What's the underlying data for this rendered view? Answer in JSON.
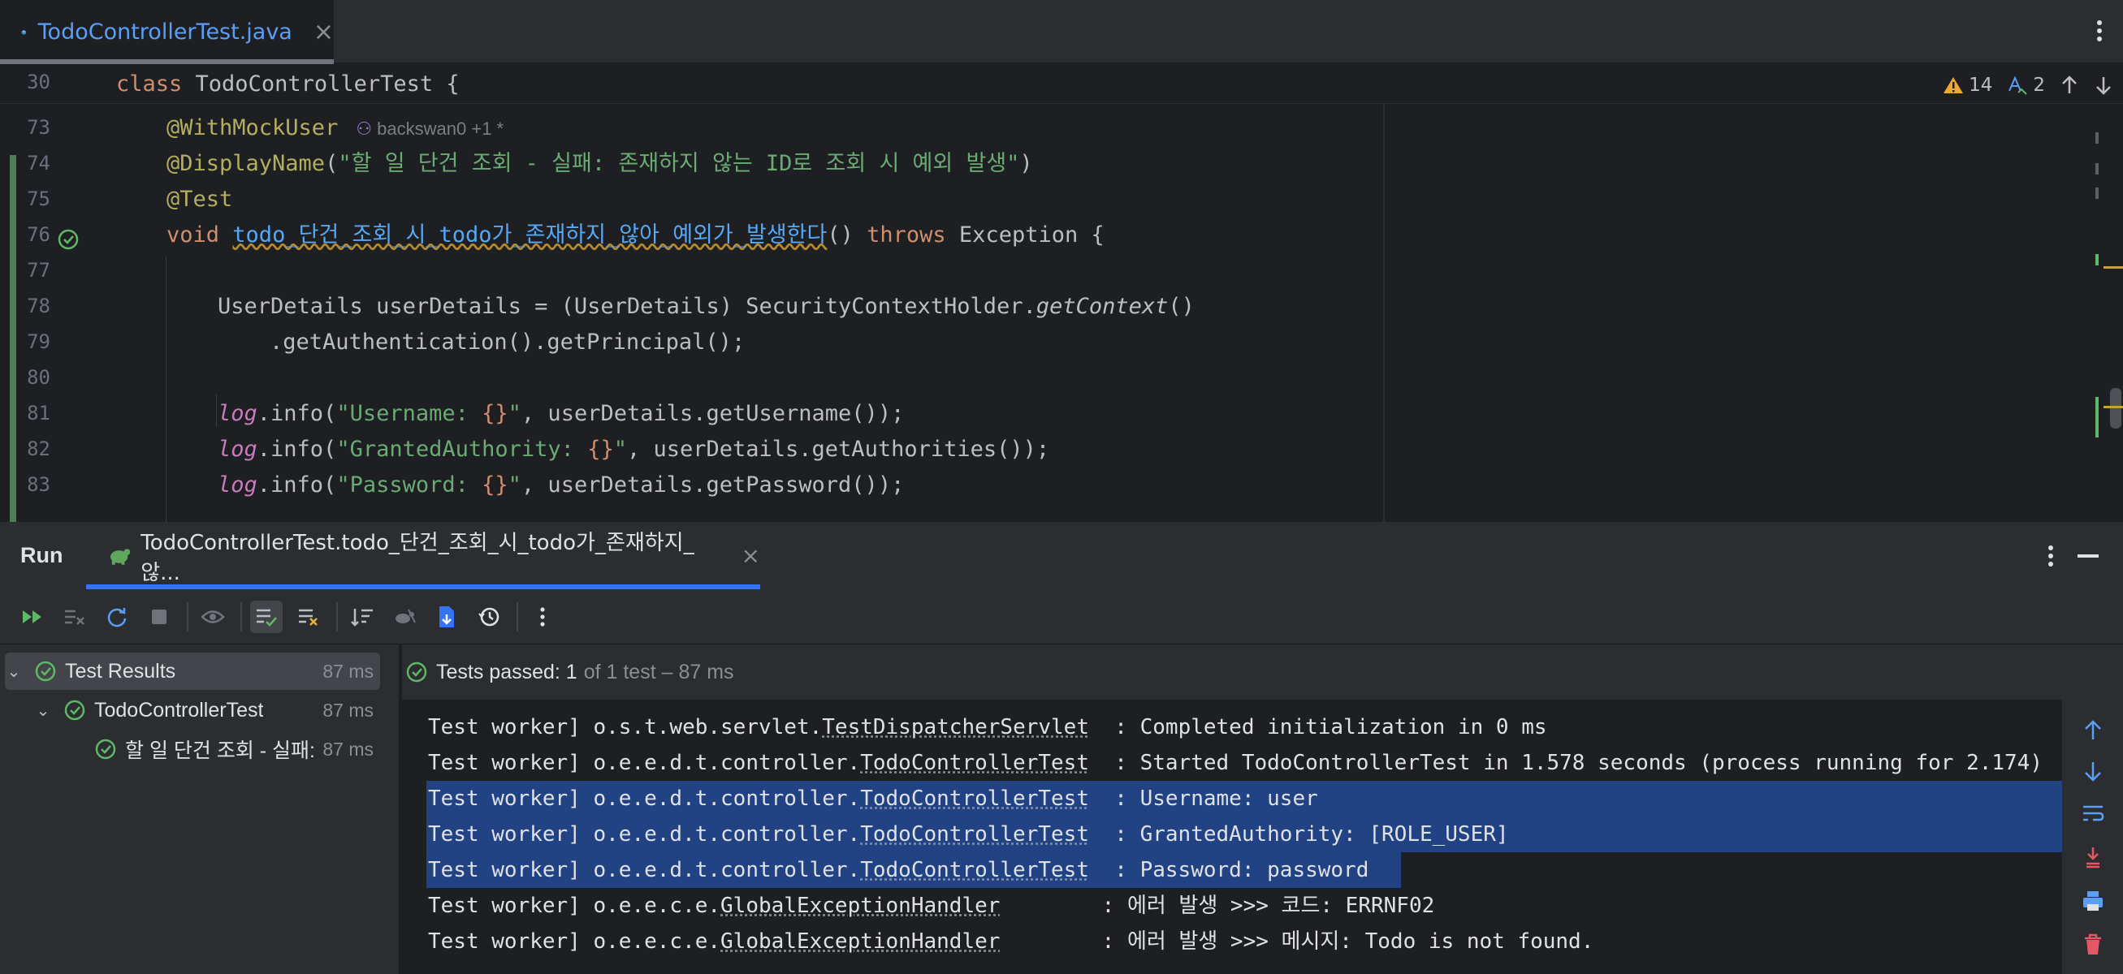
{
  "editor_tab": {
    "filename": "TodoControllerTest.java",
    "close": "×"
  },
  "sticky": {
    "line_number": "30",
    "code": "class TodoControllerTest {"
  },
  "inspections": {
    "warnings": "14",
    "typos": "2"
  },
  "gutter": {
    "line_numbers": [
      "73",
      "74",
      "75",
      "76",
      "77",
      "78",
      "79",
      "80",
      "81",
      "82",
      "83"
    ]
  },
  "code": {
    "l73_annotation": "@WithMockUser",
    "l73_author": "backswan0 +1 *",
    "l74_annotation": "@DisplayName",
    "l74_paren_open": "(",
    "l74_string": "\"할 일 단건 조회 - 실패: 존재하지 않는 ID로 조회 시 예외 발생\"",
    "l74_paren_close": ")",
    "l75_annotation": "@Test",
    "l76_void": "void",
    "l76_method": "todo_단건_조회_시_todo가_존재하지_않아_예외가_발생한다",
    "l76_parens": "() ",
    "l76_throws": "throws",
    "l76_rest": " Exception {",
    "l78_start": "UserDetails userDetails = (UserDetails) SecurityContextHolder.",
    "l78_italic": "getContext",
    "l78_end": "()",
    "l79": ".getAuthentication().getPrincipal();",
    "l81_log": "log",
    "l81_mid": ".info(",
    "l81_str1": "\"Username: ",
    "l81_ph": "{}",
    "l81_str2": "\"",
    "l81_end": ", userDetails.getUsername());",
    "l82_log": "log",
    "l82_mid": ".info(",
    "l82_str1": "\"GrantedAuthority: ",
    "l82_ph": "{}",
    "l82_str2": "\"",
    "l82_end": ", userDetails.getAuthorities());",
    "l83_log": "log",
    "l83_mid": ".info(",
    "l83_str1": "\"Password: ",
    "l83_ph": "{}",
    "l83_str2": "\"",
    "l83_end": ", userDetails.getPassword());"
  },
  "run_panel": {
    "title": "Run",
    "tab_label": "TodoControllerTest.todo_단건_조회_시_todo가_존재하지_않...",
    "tab_close": "×"
  },
  "test_tree": [
    {
      "label": "Test Results",
      "duration": "87 ms"
    },
    {
      "label": "TodoControllerTest",
      "duration": "87 ms"
    },
    {
      "label": "할 일 단건 조회 - 실패:",
      "duration": "87 ms"
    }
  ],
  "console_status": {
    "passed": "Tests passed: 1",
    "of": "of 1 test – 87 ms"
  },
  "console_lines": [
    {
      "prefix": "Test worker] o.s.t.web.servlet.",
      "cls": "TestDispatcherServlet",
      "msg": "  : Completed initialization in 0 ms"
    },
    {
      "prefix": "Test worker] o.e.e.d.t.controller.",
      "cls": "TodoControllerTest",
      "msg": "  : Started TodoControllerTest in 1.578 seconds (process running for 2.174)"
    },
    {
      "prefix": "Test worker] o.e.e.d.t.controller.",
      "cls": "TodoControllerTest",
      "msg": "  : Username: user"
    },
    {
      "prefix": "Test worker] o.e.e.d.t.controller.",
      "cls": "TodoControllerTest",
      "msg": "  : GrantedAuthority: [ROLE_USER]"
    },
    {
      "prefix": "Test worker] o.e.e.d.t.controller.",
      "cls": "TodoControllerTest",
      "msg": "  : Password: password"
    },
    {
      "prefix": "Test worker] o.e.e.c.e.",
      "cls": "GlobalExceptionHandler",
      "msg": "        : 에러 발생 >>> 코드: ERRNF02"
    },
    {
      "prefix": "Test worker] o.e.e.c.e.",
      "cls": "GlobalExceptionHandler",
      "msg": "        : 에러 발생 >>> 메시지: Todo is not found."
    }
  ],
  "colors": {
    "accent": "#3574f0",
    "selection": "#214283",
    "pass": "#5fb865",
    "tab_text": "#5a9ff5"
  }
}
